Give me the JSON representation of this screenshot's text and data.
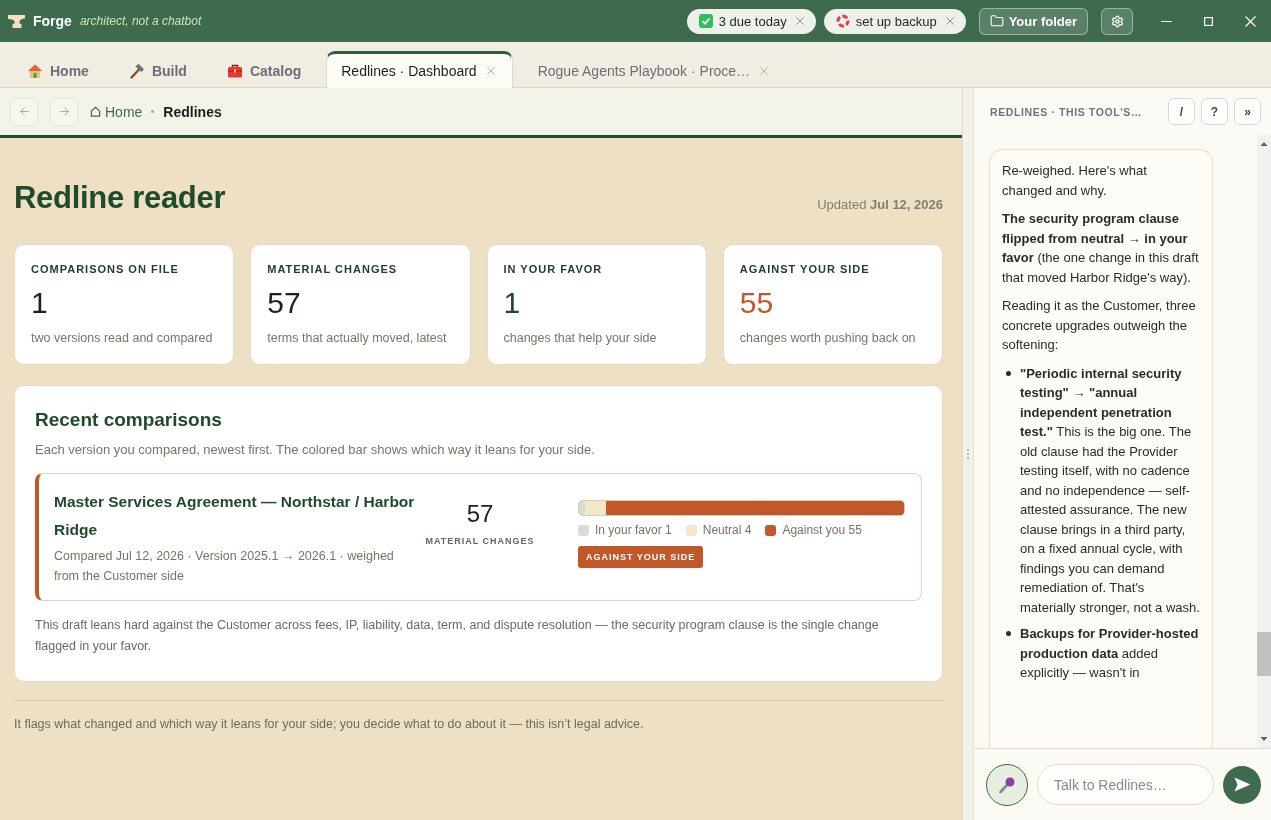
{
  "titlebar": {
    "app_name": "Forge",
    "tagline": "architect, not a chatbot",
    "chips": [
      {
        "kind": "tasks",
        "label": "3 due today"
      },
      {
        "kind": "backup",
        "label": "set up backup"
      }
    ],
    "folder_button": "Your folder"
  },
  "tabs": [
    {
      "kind": "app",
      "label": "Home",
      "selected": false
    },
    {
      "kind": "app",
      "label": "Build",
      "selected": false
    },
    {
      "kind": "app",
      "label": "Catalog",
      "selected": false
    },
    {
      "kind": "document",
      "label": "Redlines · Dashboard",
      "selected": true
    },
    {
      "kind": "document",
      "label": "Rogue Agents Playbook · Proce…",
      "selected": false
    }
  ],
  "breadcrumb": [
    {
      "label": "Home",
      "current": false
    },
    {
      "label": "Redlines",
      "current": true
    }
  ],
  "page": {
    "title": "Redline reader",
    "updated": "Updated **Jul 12, 2026**",
    "stats": [
      {
        "label": "COMPARISONS ON FILE",
        "value": "1",
        "note": "two versions read and compared",
        "color": "#1b231d"
      },
      {
        "label": "MATERIAL CHANGES",
        "value": "57",
        "note": "terms that actually moved, latest",
        "color": "#1b231d"
      },
      {
        "label": "IN YOUR FAVOR",
        "value": "1",
        "note": "changes that help your side",
        "color": "#1d4a2b"
      },
      {
        "label": "AGAINST YOUR SIDE",
        "value": "55",
        "note": "changes worth pushing back on",
        "color": "#c0582a"
      }
    ],
    "recent": {
      "title": "Recent comparisons",
      "subtitle": "Each version you compared, newest first. The colored bar shows which way it leans for your side.",
      "items": [
        {
          "title": "Master Services Agreement — Northstar / Harbor Ridge",
          "meta": "Compared Jul 12, 2026 · Version 2025.1 → 2026.1 · weighed from the Customer side",
          "count": "57",
          "count_label": "MATERIAL CHANGES",
          "color": "#c0582a",
          "badge": "AGAINST YOUR SIDE",
          "segments": [
            {
              "label": "In your favor 1",
              "level": 0.017,
              "color": "#d3dfd2"
            },
            {
              "label": "Neutral 4",
              "level": 0.067,
              "color": "#f3e7ca"
            },
            {
              "label": "Against you 55",
              "level": 0.916,
              "color": "#c0582a"
            }
          ]
        }
      ],
      "summary": "This draft leans hard against the Customer across fees, IP, liability, data, term, and dispute resolution — the security program clause is the single change flagged in your favor."
    },
    "footer": "It flags what changed and which way it leans for your side; you decide what to do about it — this isn’t legal advice."
  },
  "assistant": {
    "title": "REDLINES · THIS TOOL'S…",
    "buttons": [
      "/",
      "?",
      "»"
    ],
    "messages": [
      {
        "blocks": [
          {
            "kind": "paragraph",
            "text": "Re-weighed. Here's what changed and why."
          },
          {
            "kind": "paragraph",
            "text": "**The security program clause flipped from neutral → in your favor** (the one change in this draft that moved Harbor Ridge's way)."
          },
          {
            "kind": "paragraph",
            "text": "Reading it as the Customer, three concrete upgrades outweigh the softening:"
          },
          {
            "kind": "bullet",
            "text": "**\"Periodic internal security testing\" → \"annual independent penetration test.\"** This is the big one. The old clause had the Provider testing itself, with no cadence and no independence — self-attested assurance. The new clause brings in a third party, on a fixed annual cycle, with findings you can demand remediation of. That's materially stronger, not a wash."
          },
          {
            "kind": "bullet",
            "text": "**Backups for Provider-hosted production data** added explicitly — wasn't in"
          }
        ]
      }
    ],
    "input": {
      "placeholder": "Talk to Redlines…"
    }
  }
}
